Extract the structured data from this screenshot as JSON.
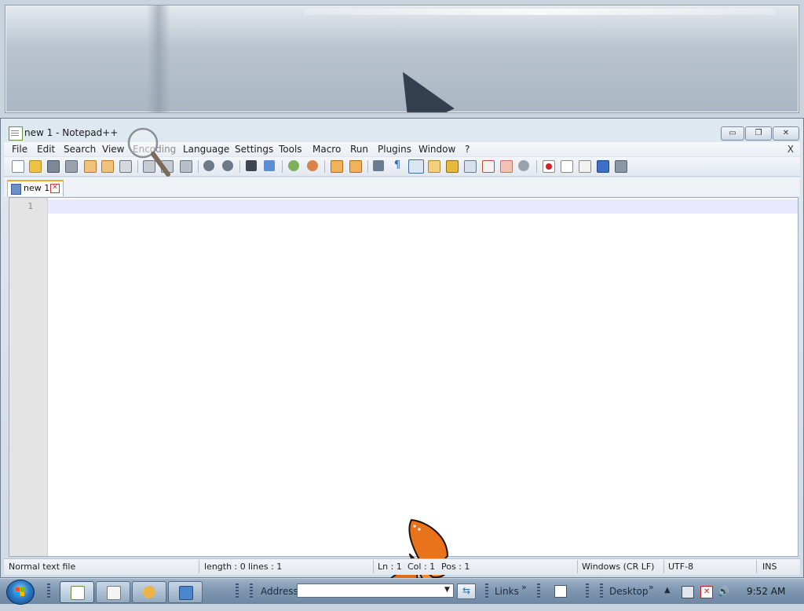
{
  "window": {
    "title": "new 1 - Notepad++",
    "min_glyph": "▭",
    "max_glyph": "❐",
    "close_glyph": "✕"
  },
  "menu": {
    "items": [
      "File",
      "Edit",
      "Search",
      "View",
      "Encoding",
      "Language",
      "Settings",
      "Tools",
      "Macro",
      "Run",
      "Plugins",
      "Window",
      "?"
    ],
    "close_doc": "X"
  },
  "toolbar": {
    "icons": [
      "new-file-icon",
      "open-file-icon",
      "save-icon",
      "save-all-icon",
      "close-icon",
      "close-all-icon",
      "print-icon",
      "cut-icon",
      "copy-icon",
      "paste-icon",
      "undo-icon",
      "redo-icon",
      "find-icon",
      "replace-icon",
      "zoom-in-icon",
      "zoom-out-icon",
      "sync-vertical-icon",
      "sync-horizontal-icon",
      "word-wrap-icon",
      "show-all-chars-icon",
      "indent-guide-icon",
      "user-lang-icon",
      "doc-map-icon",
      "function-list-icon",
      "folder-as-workspace-icon",
      "monitoring-icon",
      "macro-record-icon",
      "macro-stop-icon",
      "macro-play-icon",
      "macro-play-multiple-icon",
      "macro-save-icon"
    ]
  },
  "tabs": [
    {
      "label": "new 1",
      "close_glyph": "✕"
    }
  ],
  "editor": {
    "line_number": "1"
  },
  "status": {
    "file_type": "Normal text file",
    "length": "length : 0",
    "lines": "lines : 1",
    "ln": "Ln : 1",
    "col": "Col : 1",
    "pos": "Pos : 1",
    "eol": "Windows (CR LF)",
    "encoding": "UTF-8",
    "mode": "INS"
  },
  "taskbar": {
    "address_label": "Address",
    "address_value": "",
    "links_label": "Links",
    "desktop_label": "Desktop",
    "chevron": "»",
    "clock": "9:52 AM"
  },
  "colors": {
    "accent_tab": "#f5a623",
    "current_line": "#e8e8ff",
    "butterfly": "#e8731a"
  }
}
